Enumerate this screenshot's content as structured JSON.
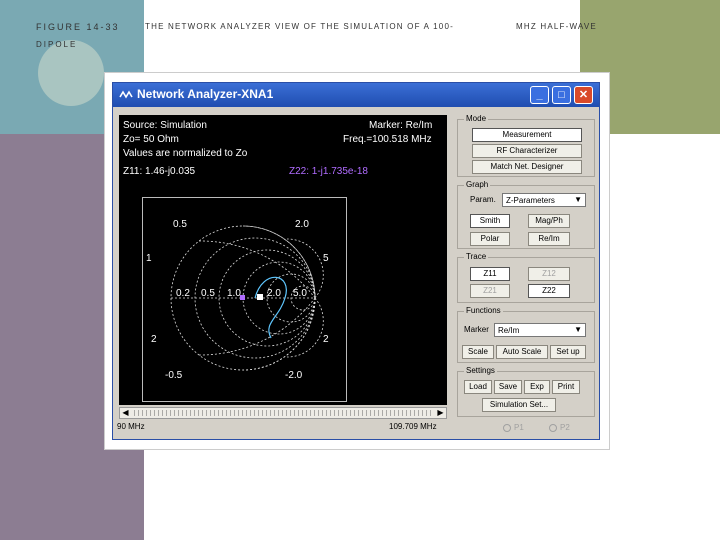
{
  "slide": {
    "caption_figure": "FIGURE 14-33",
    "caption_dipole": "DIPOLE",
    "caption_text": "THE NETWORK ANALYZER VIEW OF THE SIMULATION OF A 100-",
    "caption_tail": "MHZ HALF-WAVE"
  },
  "window": {
    "title": "Network Analyzer-XNA1",
    "buttons": {
      "minimize": "_",
      "maximize": "□",
      "close": "✕"
    }
  },
  "scope": {
    "source": "Source: Simulation",
    "marker": "Marker: Re/Im",
    "zo": "Zo= 50 Ohm",
    "freq": "Freq.=100.518 MHz",
    "normalized": "Values are normalized to Zo",
    "z11": "Z11: 1.46-j0.035",
    "z22": "Z22: 1-j1.735e-18",
    "labels": {
      "r02": "0.2",
      "r05": "0.5",
      "r10": "1.0",
      "r20": "2.0",
      "r50": "5.0",
      "x05_top": "0.5",
      "x20_top": "2.0",
      "x5_right": "5",
      "x2_left": "2",
      "x2_right": "2",
      "x05_bot": "-0.5",
      "x20_bot": "-2.0",
      "x1_left": "1"
    },
    "colors": {
      "text": "#ffffff",
      "z22": "#b06cff",
      "trace": "#5fc7ff",
      "grid": "#dddddd"
    }
  },
  "freq_axis": {
    "left": "90 MHz",
    "right": "109.709 MHz"
  },
  "panel": {
    "mode": {
      "title": "Mode",
      "measurement": "Measurement",
      "rf": "RF Characterizer",
      "match": "Match Net. Designer"
    },
    "graph": {
      "title": "Graph",
      "param_label": "Param.",
      "param_value": "Z-Parameters",
      "smith": "Smith",
      "magph": "Mag/Ph",
      "polar": "Polar",
      "reim": "Re/Im"
    },
    "trace": {
      "title": "Trace",
      "z11": "Z11",
      "z12": "Z12",
      "z21": "Z21",
      "z22": "Z22"
    },
    "functions": {
      "title": "Functions",
      "marker_label": "Marker",
      "marker_value": "Re/Im",
      "scale": "Scale",
      "auto_scale": "Auto Scale",
      "setup": "Set up"
    },
    "settings": {
      "title": "Settings",
      "load": "Load",
      "save": "Save",
      "exp": "Exp",
      "print": "Print",
      "simset": "Simulation Set..."
    },
    "ports": {
      "p1": "P1",
      "p2": "P2"
    }
  }
}
